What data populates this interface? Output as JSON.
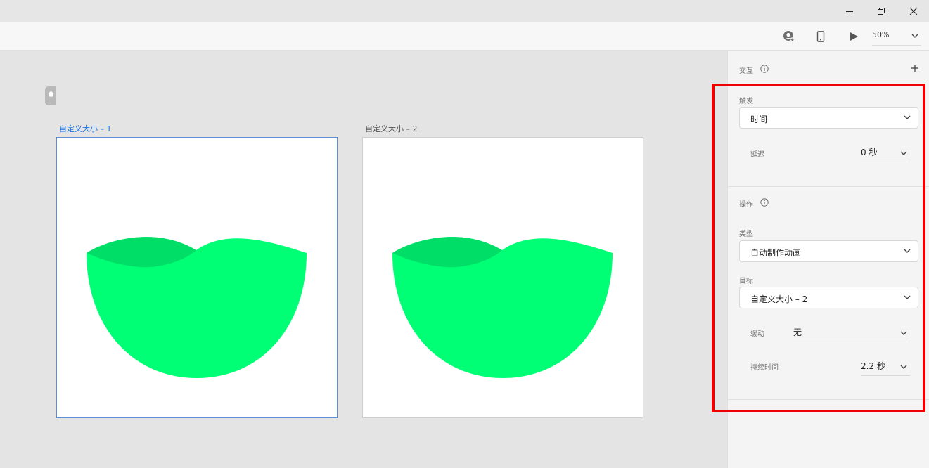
{
  "window": {
    "controls": [
      "minimize-icon",
      "restore-icon",
      "close-icon"
    ]
  },
  "toolbar": {
    "icons": [
      "share-user-icon",
      "mobile-preview-icon",
      "play-icon",
      "chevron-down-icon"
    ],
    "zoom": "50%"
  },
  "canvas": {
    "artboards": [
      {
        "label": "自定义大小 – 1",
        "selected": true
      },
      {
        "label": "自定义大小 – 2",
        "selected": false
      }
    ],
    "colors": {
      "selected_label": "#1a73e8",
      "shape_main": "#00ff74",
      "shape_shade": "#00de68"
    }
  },
  "panel": {
    "interaction_title": "交互",
    "trigger": {
      "label": "触发",
      "value": "时间"
    },
    "delay": {
      "label": "延迟",
      "value": "0 秒"
    },
    "action_title": "操作",
    "type": {
      "label": "类型",
      "value": "自动制作动画"
    },
    "target": {
      "label": "目标",
      "value": "自定义大小 – 2"
    },
    "easing": {
      "label": "缓动",
      "value": "无"
    },
    "duration": {
      "label": "持续时间",
      "value": "2.2 秒"
    }
  },
  "highlight_color": "#ee0000"
}
